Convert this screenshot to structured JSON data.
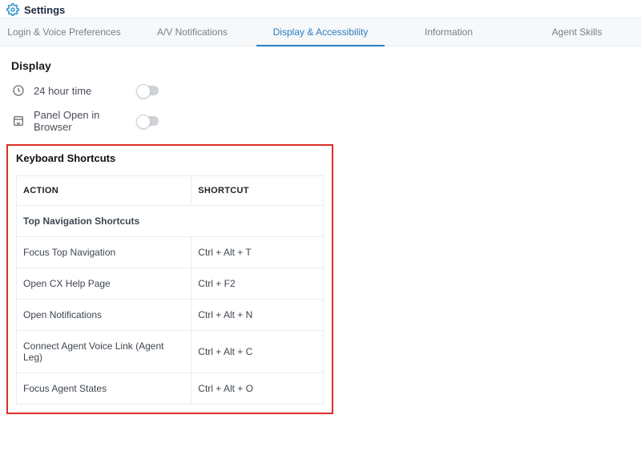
{
  "header": {
    "title": "Settings"
  },
  "tabs": {
    "items": [
      {
        "label": "Login & Voice Preferences"
      },
      {
        "label": "A/V Notifications"
      },
      {
        "label": "Display & Accessibility"
      },
      {
        "label": "Information"
      },
      {
        "label": "Agent Skills"
      }
    ]
  },
  "display": {
    "section_label": "Display",
    "option1_label": "24 hour time",
    "option2_label": "Panel Open in Browser"
  },
  "shortcuts": {
    "section_label": "Keyboard Shortcuts",
    "columns": {
      "action": "ACTION",
      "shortcut": "SHORTCUT"
    },
    "subheader": "Top Navigation Shortcuts",
    "rows": [
      {
        "action": "Focus Top Navigation",
        "shortcut": "Ctrl + Alt + T"
      },
      {
        "action": "Open CX Help Page",
        "shortcut": "Ctrl + F2"
      },
      {
        "action": "Open Notifications",
        "shortcut": "Ctrl + Alt + N"
      },
      {
        "action": "Connect Agent Voice Link (Agent Leg)",
        "shortcut": "Ctrl + Alt + C"
      },
      {
        "action": "Focus Agent States",
        "shortcut": "Ctrl + Alt + O"
      }
    ]
  }
}
